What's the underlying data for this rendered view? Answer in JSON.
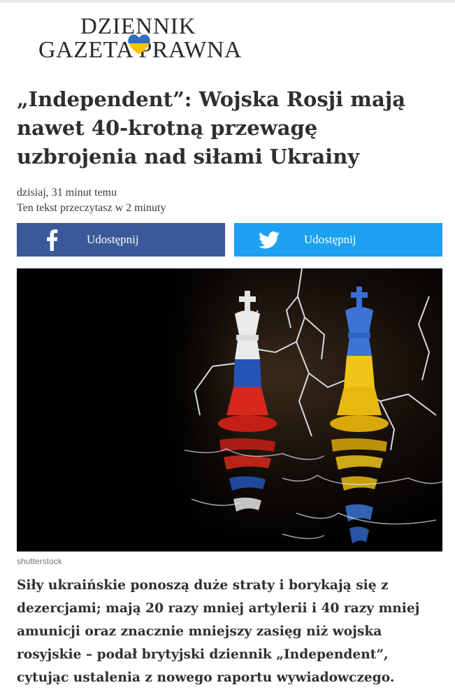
{
  "site": {
    "logo_line1": "DZIENNIK",
    "logo_line2": "GAZETA PRAWNA",
    "flag_colors": [
      "#2e6fbf",
      "#f5c400"
    ]
  },
  "article": {
    "title": "„Independent”: Wojska Rosji mają nawet 40-krotną przewagę uzbrojenia nad siłami Ukrainy",
    "published": "dzisiaj, 31 minut temu",
    "reading_time": "Ten tekst przeczytasz w 2 minuty",
    "image_credit": "shutterstock",
    "lead": "Siły ukraińskie ponoszą duże straty i borykają się z dezercjami; mają 20 razy mniej artylerii i 40 razy mniej amunicji oraz znacznie mniejszy zasięg niż wojska rosyjskie – podał brytyjski dziennik „Independent”, cytując ustalenia z nowego raportu wywiadowczego."
  },
  "share": {
    "facebook_label": "Udostępnij",
    "twitter_label": "Udostępnij",
    "facebook_color": "#3b5998",
    "twitter_color": "#1da1f2",
    "facebook_icon": "facebook-icon",
    "twitter_icon": "twitter-icon"
  }
}
